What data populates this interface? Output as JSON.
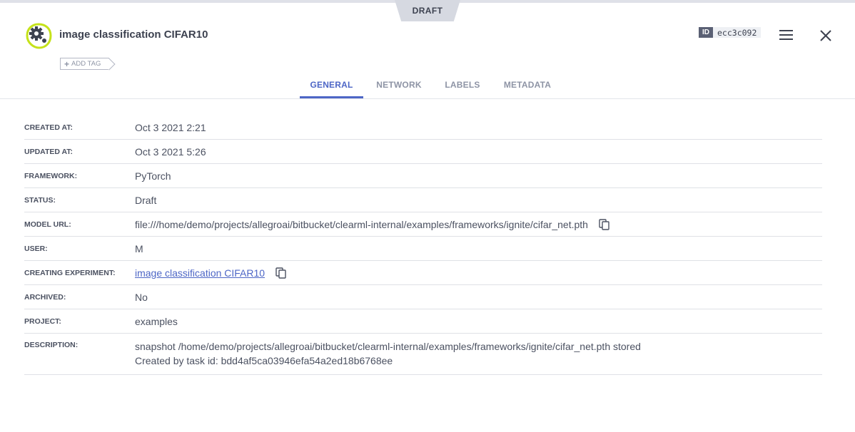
{
  "header": {
    "draft_label": "DRAFT",
    "title": "image classification CIFAR10",
    "add_tag_label": "ADD TAG",
    "id_badge": "ID",
    "id_value": "ecc3c092"
  },
  "tabs": [
    {
      "label": "GENERAL",
      "active": true
    },
    {
      "label": "NETWORK",
      "active": false
    },
    {
      "label": "LABELS",
      "active": false
    },
    {
      "label": "METADATA",
      "active": false
    }
  ],
  "details": {
    "created_at": {
      "label": "CREATED AT:",
      "value": "Oct 3 2021 2:21"
    },
    "updated_at": {
      "label": "UPDATED AT:",
      "value": "Oct 3 2021 5:26"
    },
    "framework": {
      "label": "FRAMEWORK:",
      "value": "PyTorch"
    },
    "status": {
      "label": "STATUS:",
      "value": "Draft"
    },
    "model_url": {
      "label": "MODEL URL:",
      "value": "file:///home/demo/projects/allegroai/bitbucket/clearml-internal/examples/frameworks/ignite/cifar_net.pth"
    },
    "user": {
      "label": "USER:",
      "value": "M"
    },
    "creating_experiment": {
      "label": "CREATING EXPERIMENT:",
      "value": "image classification CIFAR10"
    },
    "archived": {
      "label": "ARCHIVED:",
      "value": "No"
    },
    "project": {
      "label": "PROJECT:",
      "value": "examples"
    },
    "description": {
      "label": "DESCRIPTION:",
      "line1": "snapshot /home/demo/projects/allegroai/bitbucket/clearml-internal/examples/frameworks/ignite/cifar_net.pth stored",
      "line2": "Created by task id: bdd4af5ca03946efa54a2ed18b6768ee"
    }
  },
  "colors": {
    "accent": "#4d66c6",
    "icon_ring": "#c5e21a",
    "text": "#4b5161"
  },
  "icons": {
    "model": "gear-icon",
    "menu": "hamburger-icon",
    "close": "close-icon",
    "copy": "copy-icon"
  }
}
